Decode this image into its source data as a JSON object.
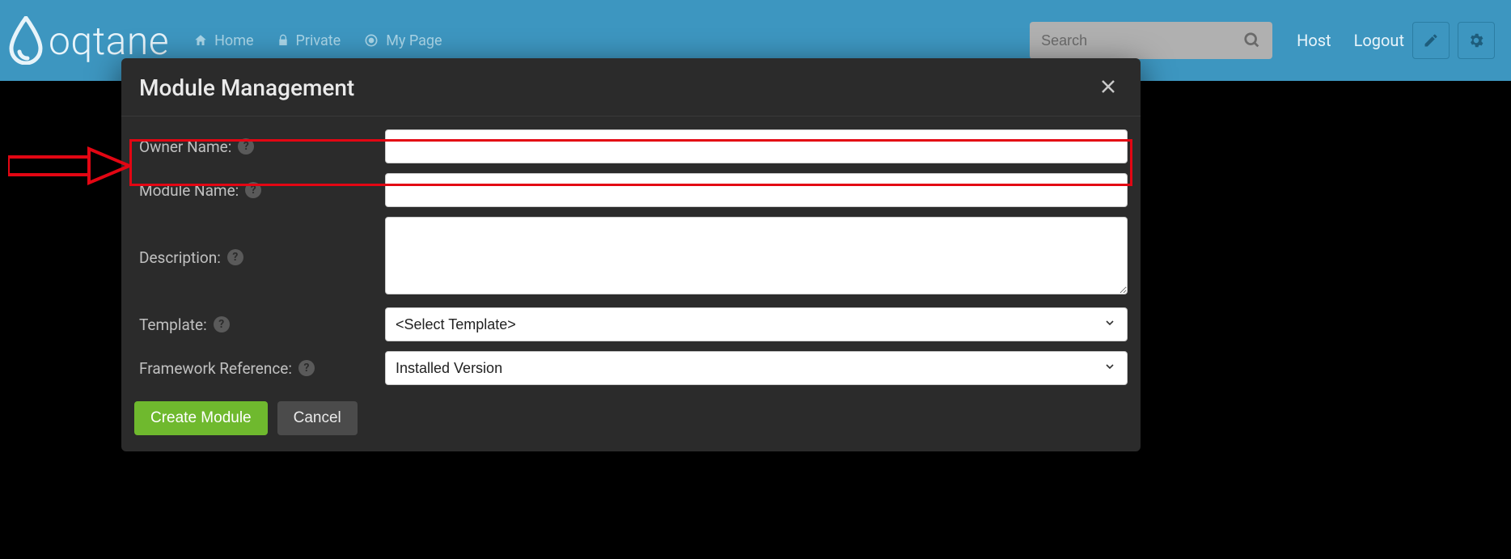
{
  "brand": {
    "name": "oqtane"
  },
  "nav": {
    "home": "Home",
    "private": "Private",
    "mypage": "My Page"
  },
  "search": {
    "placeholder": "Search"
  },
  "user": {
    "host": "Host",
    "logout": "Logout"
  },
  "modal": {
    "title": "Module Management",
    "fields": {
      "owner_label": "Owner Name:",
      "owner_value": "",
      "module_label": "Module Name:",
      "module_value": "",
      "description_label": "Description:",
      "description_value": "",
      "template_label": "Template:",
      "template_selected": "<Select Template>",
      "framework_label": "Framework Reference:",
      "framework_selected": "Installed Version"
    },
    "buttons": {
      "create": "Create Module",
      "cancel": "Cancel"
    }
  }
}
